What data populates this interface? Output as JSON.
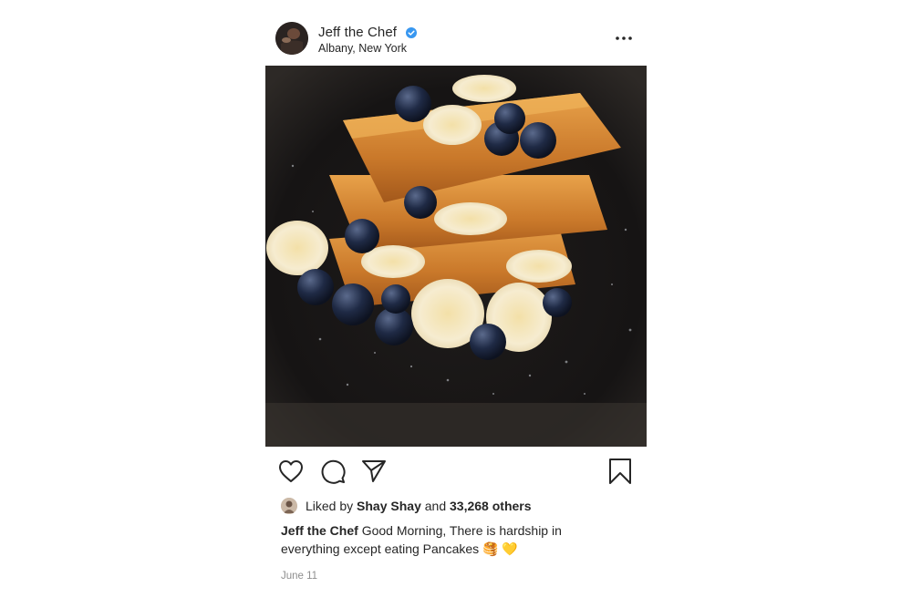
{
  "post": {
    "author": {
      "username": "Jeff the Chef",
      "location": "Albany, New York",
      "verified": true
    },
    "photo_description": "french-toast-with-bananas-and-blueberries",
    "actions": {
      "like_icon": "heart-icon",
      "comment_icon": "comment-icon",
      "share_icon": "send-icon",
      "save_icon": "bookmark-icon"
    },
    "likes": {
      "prefix": "Liked by",
      "liker": "Shay Shay",
      "joiner": "and",
      "others": "33,268 others"
    },
    "caption": {
      "username": "Jeff the Chef",
      "text": "Good Morning, There is hardship in everything except eating Pancakes",
      "emoji": "🥞 💛"
    },
    "date": "June 11"
  },
  "colors": {
    "verified_badge": "#3897f0",
    "text": "#262626",
    "muted": "#8e8e8e"
  }
}
